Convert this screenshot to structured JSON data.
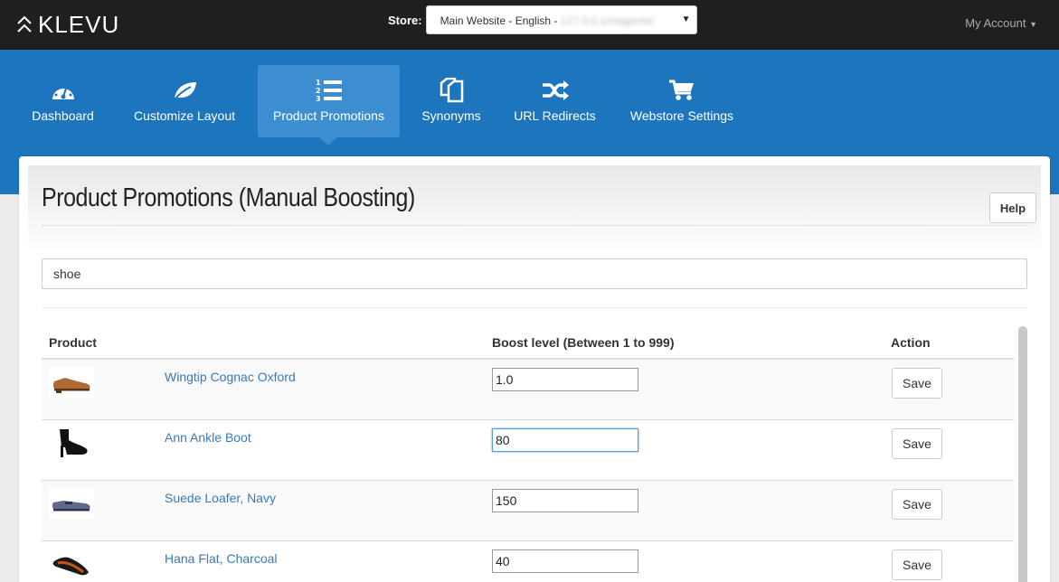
{
  "brand": {
    "name": "KLEVU"
  },
  "store": {
    "label": "Store:",
    "selected": "Main Website - English - ",
    "selected_blurred": "127.0.0.1/magento/"
  },
  "account": {
    "label": "My Account"
  },
  "nav": {
    "items": [
      {
        "label": "Dashboard",
        "icon": "gauge-icon"
      },
      {
        "label": "Customize Layout",
        "icon": "leaf-icon"
      },
      {
        "label": "Product Promotions",
        "icon": "numbered-list-icon",
        "active": true
      },
      {
        "label": "Synonyms",
        "icon": "copy-pages-icon"
      },
      {
        "label": "URL Redirects",
        "icon": "shuffle-icon"
      },
      {
        "label": "Webstore Settings",
        "icon": "cart-icon"
      }
    ]
  },
  "page": {
    "title": "Product Promotions (Manual Boosting)",
    "help_label": "Help",
    "search_value": "shoe"
  },
  "table": {
    "headers": {
      "product": "Product",
      "boost": "Boost level (Between 1 to 999)",
      "action": "Action"
    },
    "rows": [
      {
        "name": "Wingtip Cognac Oxford",
        "boost": "1.0",
        "action": "Save"
      },
      {
        "name": "Ann Ankle Boot",
        "boost": "80",
        "action": "Save"
      },
      {
        "name": "Suede Loafer, Navy",
        "boost": "150",
        "action": "Save"
      },
      {
        "name": "Hana Flat, Charcoal",
        "boost": "40",
        "action": "Save"
      }
    ]
  },
  "colors": {
    "topbar": "#1f1f1f",
    "nav": "#1c75bd",
    "nav_active": "#3d8ed0",
    "link": "#3a7ab8"
  }
}
